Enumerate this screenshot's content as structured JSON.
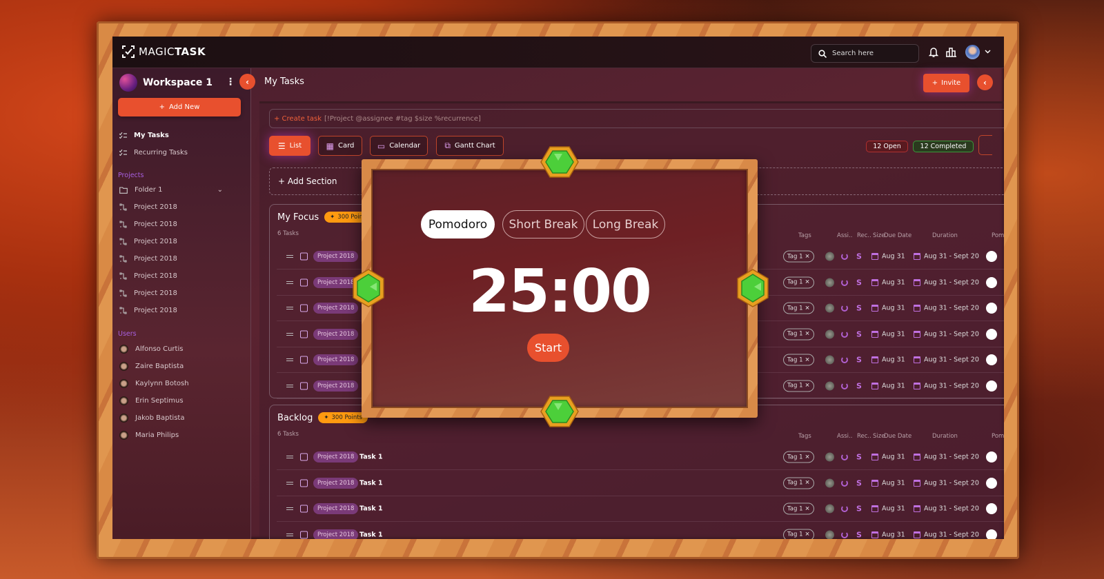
{
  "app": {
    "logo_light": "MAGIC",
    "logo_bold": "TASK"
  },
  "topbar": {
    "search_placeholder": "Search here",
    "icons": [
      "search-icon",
      "bell-icon",
      "chart-icon",
      "avatar",
      "chevron-down-icon"
    ]
  },
  "sidebar": {
    "workspace": "Workspace 1",
    "add_new": "Add New",
    "nav": [
      {
        "label": "My Tasks",
        "active": true
      },
      {
        "label": "Recurring Tasks",
        "active": false
      }
    ],
    "projects_heading": "Projects",
    "folder": "Folder 1",
    "projects": [
      "Project 2018",
      "Project 2018",
      "Project 2018",
      "Project 2018",
      "Project 2018",
      "Project 2018",
      "Project 2018"
    ],
    "users_heading": "Users",
    "users": [
      "Alfonso Curtis",
      "Zaire Baptista",
      "Kaylynn Botosh",
      "Erin Septimus",
      "Jakob Baptista",
      "Maria Philips"
    ]
  },
  "header": {
    "title": "My Tasks",
    "invite": "Invite"
  },
  "toolbar": {
    "create_prefix": "+ Create task",
    "create_hint": "[!Project @assignee #tag $size %recurrence]",
    "views": [
      {
        "label": "List",
        "icon": "list-icon",
        "active": true
      },
      {
        "label": "Card",
        "icon": "grid-icon"
      },
      {
        "label": "Calendar",
        "icon": "calendar-icon"
      },
      {
        "label": "Gantt Chart",
        "icon": "gantt-icon"
      }
    ],
    "open": "12 Open",
    "completed": "12 Completed",
    "add_section": "+ Add Section"
  },
  "columns": [
    "Tags",
    "Assi..",
    "Rec..",
    "Size",
    "Due Date",
    "Duration",
    "Pomo"
  ],
  "sections": [
    {
      "title": "My Focus",
      "points": "300 Points",
      "count": "6 Tasks",
      "rows": [
        {
          "project": "Project 2018",
          "task": "",
          "tag": "Tag 1",
          "size": "S",
          "due": "Aug 31",
          "duration": "Aug 31 - Sept 20"
        },
        {
          "project": "Project 2018",
          "task": "",
          "tag": "Tag 1",
          "size": "S",
          "due": "Aug 31",
          "duration": "Aug 31 - Sept 20"
        },
        {
          "project": "Project 2018",
          "task": "",
          "tag": "Tag 1",
          "size": "S",
          "due": "Aug 31",
          "duration": "Aug 31 - Sept 20"
        },
        {
          "project": "Project 2018",
          "task": "",
          "tag": "Tag 1",
          "size": "S",
          "due": "Aug 31",
          "duration": "Aug 31 - Sept 20"
        },
        {
          "project": "Project 2018",
          "task": "",
          "tag": "Tag 1",
          "size": "S",
          "due": "Aug 31",
          "duration": "Aug 31 - Sept 20"
        },
        {
          "project": "Project 2018",
          "task": "",
          "tag": "Tag 1",
          "size": "S",
          "due": "Aug 31",
          "duration": "Aug 31 - Sept 20"
        }
      ]
    },
    {
      "title": "Backlog",
      "points": "300 Points",
      "count": "6 Tasks",
      "rows": [
        {
          "project": "Project 2018",
          "task": "Task 1",
          "tag": "Tag 1",
          "size": "S",
          "due": "Aug 31",
          "duration": "Aug 31 - Sept 20"
        },
        {
          "project": "Project 2018",
          "task": "Task 1",
          "tag": "Tag 1",
          "size": "S",
          "due": "Aug 31",
          "duration": "Aug 31 - Sept 20"
        },
        {
          "project": "Project 2018",
          "task": "Task 1",
          "tag": "Tag 1",
          "size": "S",
          "due": "Aug 31",
          "duration": "Aug 31 - Sept 20"
        },
        {
          "project": "Project 2018",
          "task": "Task 1",
          "tag": "Tag 1",
          "size": "S",
          "due": "Aug 31",
          "duration": "Aug 31 - Sept 20"
        }
      ]
    }
  ],
  "pomodoro": {
    "modes": [
      {
        "label": "Pomodoro",
        "selected": true
      },
      {
        "label": "Short Break"
      },
      {
        "label": "Long Break"
      }
    ],
    "time": "25:00",
    "start": "Start"
  },
  "colors": {
    "accent": "#e8502e",
    "purple": "#a860e0",
    "points": "#ff9a10",
    "gem": "#4ccf3a"
  }
}
